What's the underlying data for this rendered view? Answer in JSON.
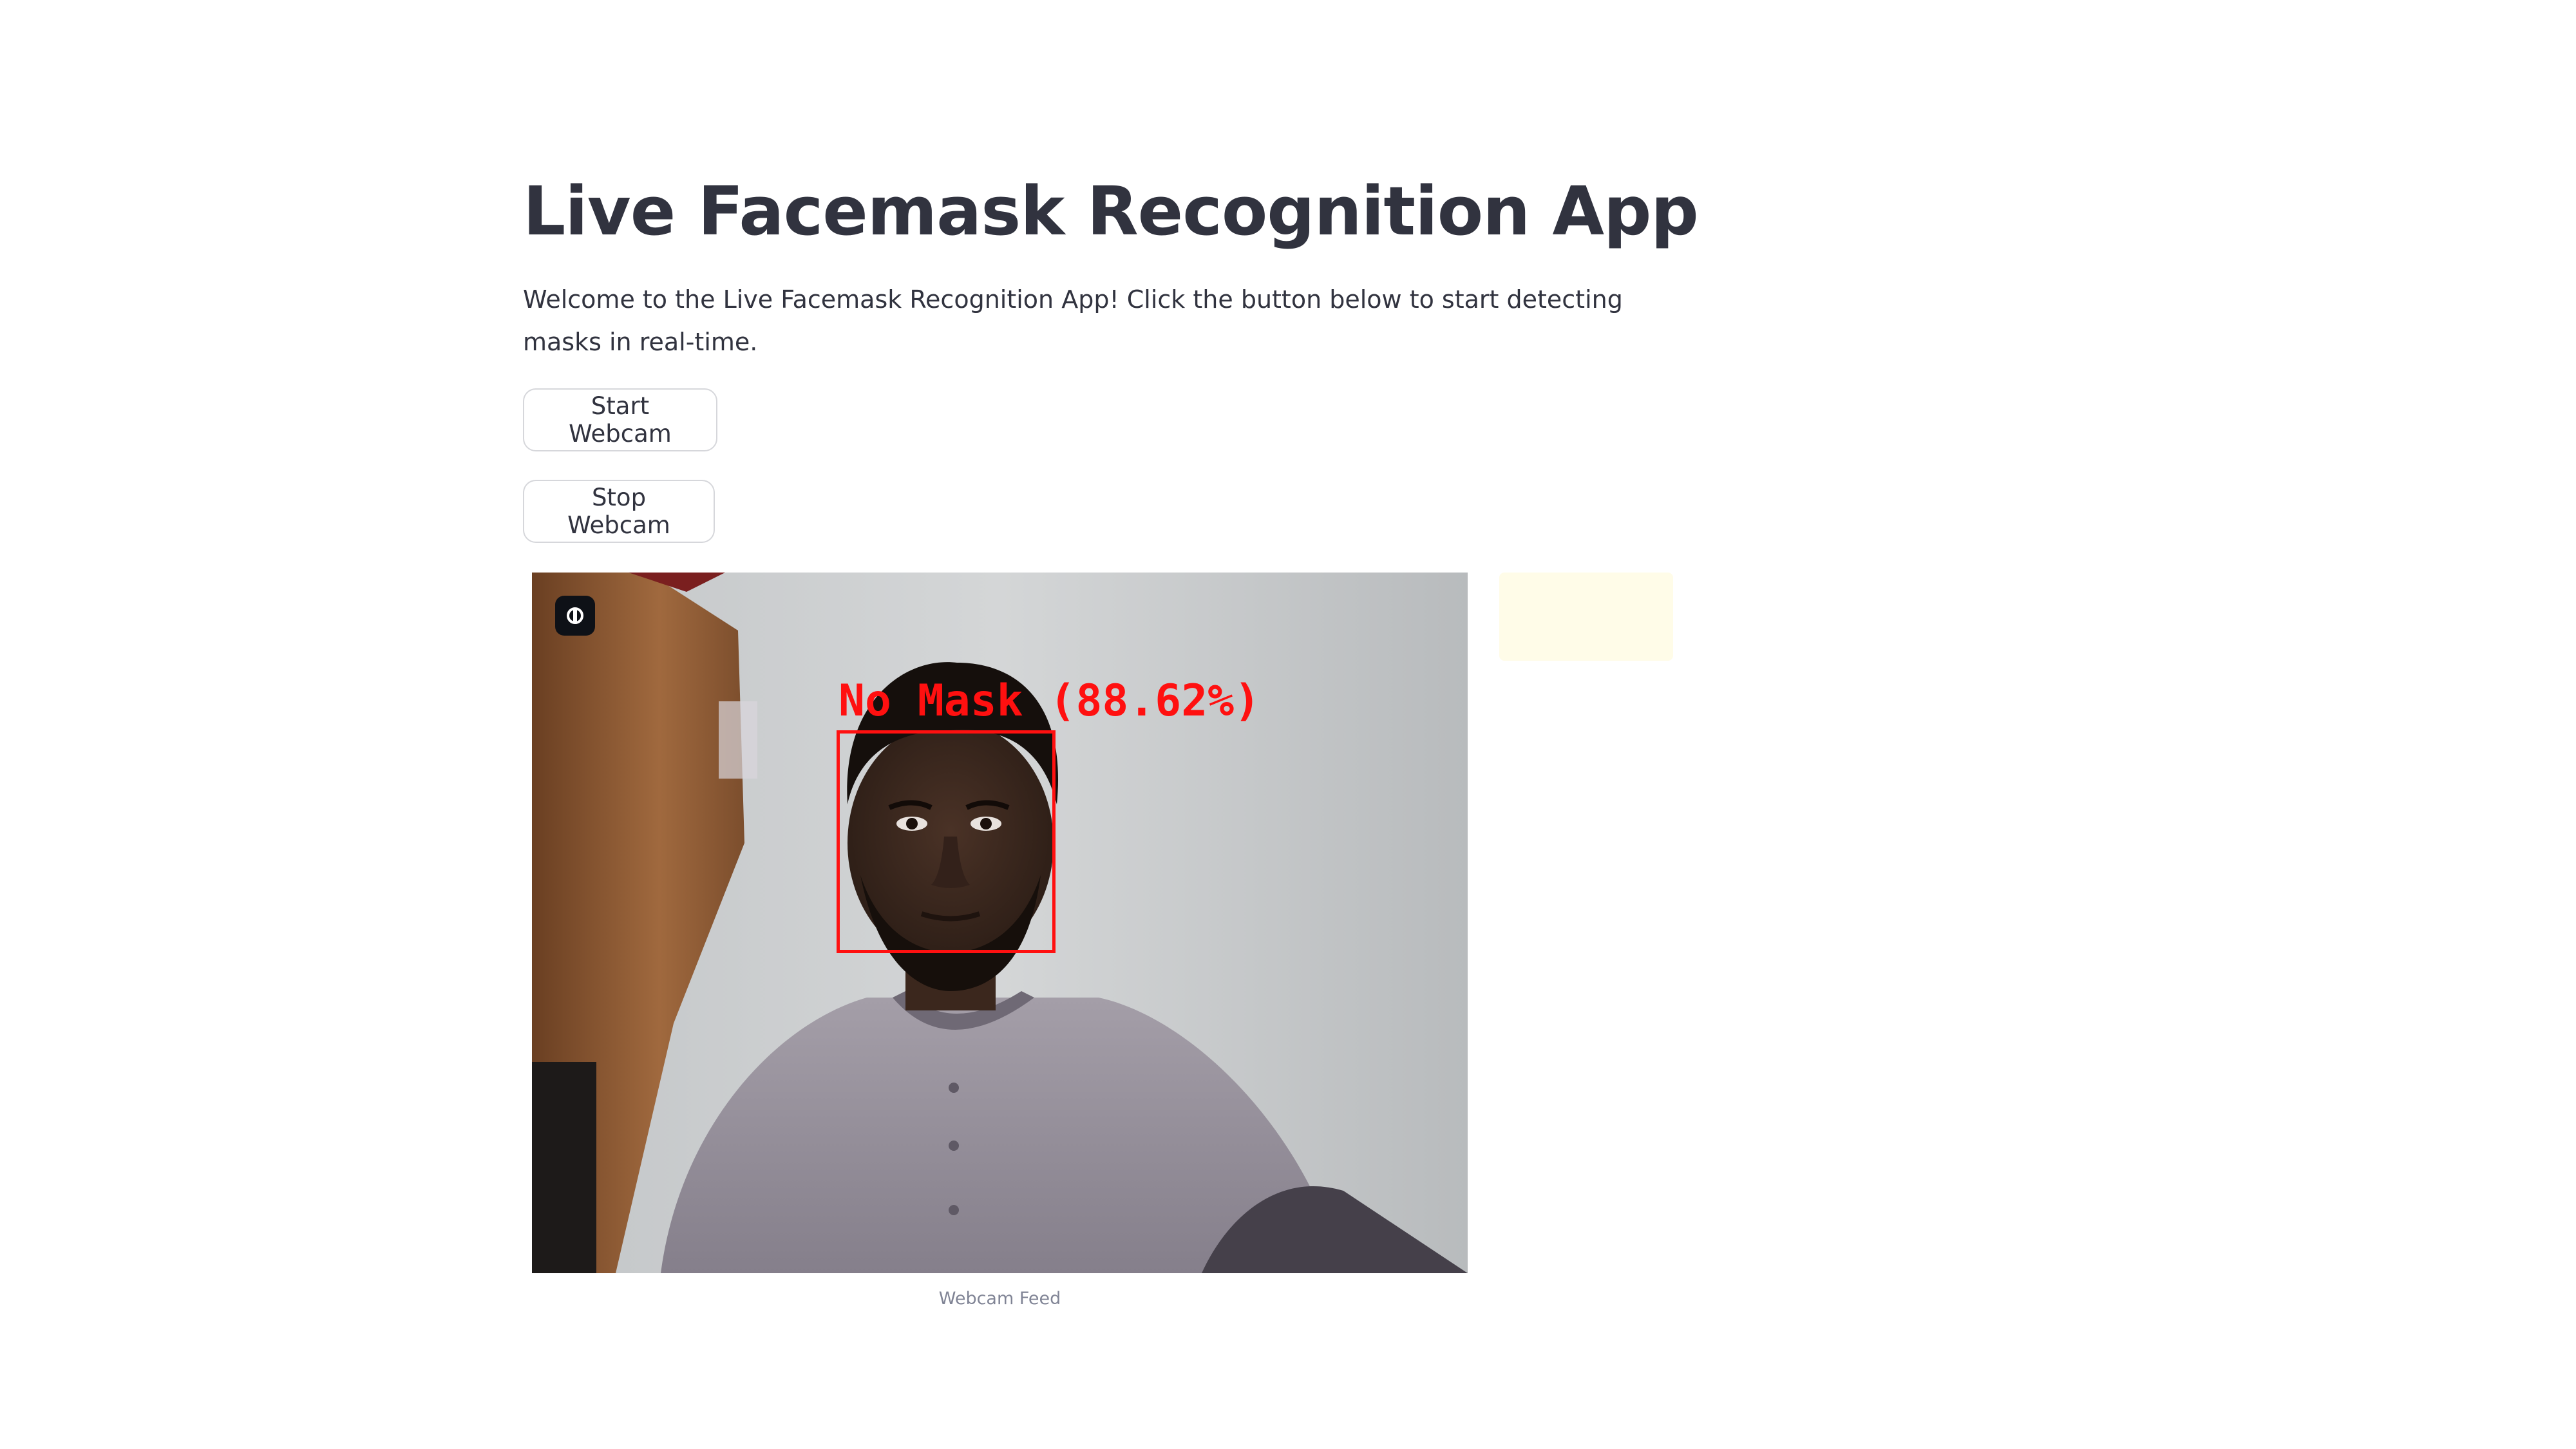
{
  "page": {
    "title": "Live Facemask Recognition App",
    "intro": "Welcome to the Live Facemask Recognition App! Click the button below to start detecting masks in real-time."
  },
  "buttons": {
    "start_label": "Start Webcam",
    "stop_label": "Stop Webcam"
  },
  "feed": {
    "caption": "Webcam Feed",
    "badge_icon": "camera-switch-icon",
    "detection": {
      "label": "No Mask (88.62%)",
      "color": "#ff1010"
    }
  },
  "status_box": {
    "color": "#fffce8"
  },
  "colors": {
    "text": "#31333f",
    "caption": "#808495",
    "border": "#d6d7db"
  }
}
